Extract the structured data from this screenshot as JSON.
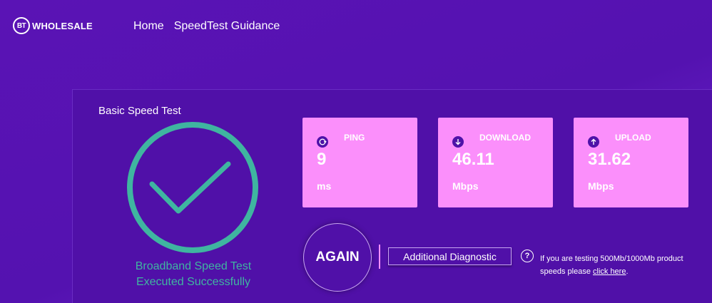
{
  "header": {
    "logo_mark": "BT",
    "logo_text": "WHOLESALE",
    "nav": [
      "Home",
      "SpeedTest Guidance"
    ]
  },
  "panel": {
    "title": "Basic Speed Test",
    "success_line1": "Broadband Speed Test",
    "success_line2": "Executed Successfully"
  },
  "metrics": [
    {
      "label": "PING",
      "value": "9",
      "unit": "ms",
      "icon": "ping-icon"
    },
    {
      "label": "DOWNLOAD",
      "value": "46.11",
      "unit": "Mbps",
      "icon": "arrow-down-icon"
    },
    {
      "label": "UPLOAD",
      "value": "31.62",
      "unit": "Mbps",
      "icon": "arrow-up-icon"
    }
  ],
  "actions": {
    "again_label": "AGAIN",
    "diagnostic_label": "Additional Diagnostic",
    "help_glyph": "?",
    "note_text": "If you are testing 500Mb/1000Mb product speeds please ",
    "note_link": "click here",
    "note_end": "."
  },
  "colors": {
    "background": "#5412b0",
    "card": "#fb8ffb",
    "success": "#3fb5a0"
  }
}
